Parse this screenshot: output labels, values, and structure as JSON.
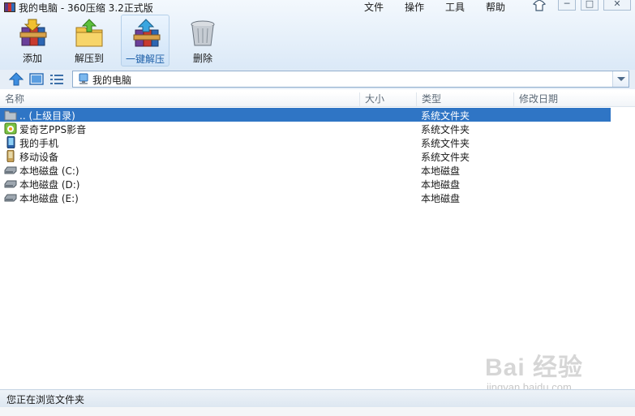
{
  "window": {
    "title": "我的电脑 - 360压缩 3.2正式版"
  },
  "menu": {
    "items": [
      "文件",
      "操作",
      "工具",
      "帮助"
    ]
  },
  "window_controls": {
    "icons": [
      "skin-icon",
      "minimize-icon",
      "maximize-icon",
      "close-icon"
    ]
  },
  "toolbar": {
    "add": "添加",
    "extract_to": "解压到",
    "one_click_extract": "一键解压",
    "delete": "删除",
    "active": "一键解压"
  },
  "nav": {
    "icons": [
      "up-arrow-icon",
      "thumbnail-view-icon",
      "list-view-icon"
    ]
  },
  "address": {
    "value": "我的电脑",
    "icon": "computer-icon"
  },
  "columns": {
    "name": "名称",
    "size": "大小",
    "type": "类型",
    "modified": "修改日期"
  },
  "files": [
    {
      "name": ".. (上级目录)",
      "size": "",
      "type": "系统文件夹",
      "modified": "",
      "icon": "folder-up-icon",
      "selected": true
    },
    {
      "name": "爱奇艺PPS影音",
      "size": "",
      "type": "系统文件夹",
      "modified": "",
      "icon": "pps-app-icon",
      "selected": false
    },
    {
      "name": "我的手机",
      "size": "",
      "type": "系统文件夹",
      "modified": "",
      "icon": "phone-icon",
      "selected": false
    },
    {
      "name": "移动设备",
      "size": "",
      "type": "系统文件夹",
      "modified": "",
      "icon": "mobile-device-icon",
      "selected": false
    },
    {
      "name": "本地磁盘 (C:)",
      "size": "",
      "type": "本地磁盘",
      "modified": "",
      "icon": "drive-icon",
      "selected": false
    },
    {
      "name": "本地磁盘 (D:)",
      "size": "",
      "type": "本地磁盘",
      "modified": "",
      "icon": "drive-icon",
      "selected": false
    },
    {
      "name": "本地磁盘 (E:)",
      "size": "",
      "type": "本地磁盘",
      "modified": "",
      "icon": "drive-icon",
      "selected": false
    }
  ],
  "watermark": {
    "brand": "Bai 经验",
    "url": "jingyan.baidu.com"
  },
  "status": {
    "text": "您正在浏览文件夹"
  },
  "colors": {
    "selection": "#2f75c5",
    "toolbar_bg": "#e6f0fa",
    "active_label": "#1d5fa8"
  }
}
